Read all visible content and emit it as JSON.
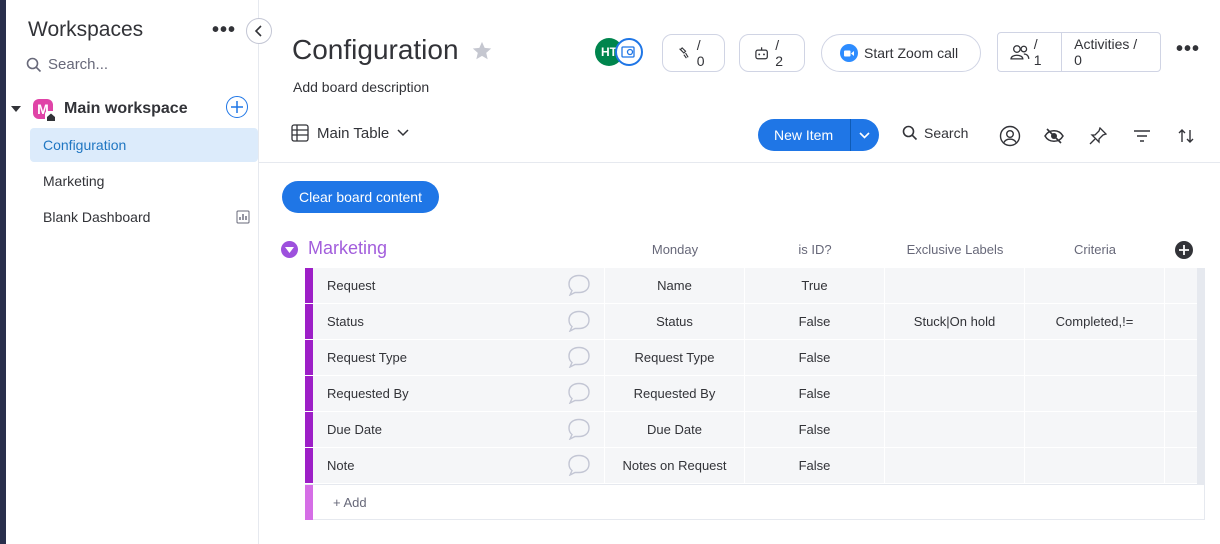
{
  "sidebar": {
    "title": "Workspaces",
    "search_placeholder": "Search...",
    "workspace": {
      "initial": "M",
      "name": "Main workspace"
    },
    "items": [
      {
        "label": "Configuration",
        "active": true
      },
      {
        "label": "Marketing",
        "active": false
      },
      {
        "label": "Blank Dashboard",
        "active": false
      }
    ]
  },
  "header": {
    "title": "Configuration",
    "description": "Add board description",
    "avatar_initials": "HT",
    "integrations_count": "/ 0",
    "automations_count": "/ 2",
    "zoom_label": "Start Zoom call",
    "members_count": "/ 1",
    "activities_label": "Activities / 0"
  },
  "toolbar": {
    "view_label": "Main Table",
    "new_item_label": "New Item",
    "search_label": "Search"
  },
  "clear_button": "Clear board content",
  "group": {
    "name": "Marketing",
    "color": "#a25ddc",
    "columns": [
      "Monday",
      "is ID?",
      "Exclusive Labels",
      "Criteria"
    ],
    "rows": [
      {
        "name": "Request",
        "monday": "Name",
        "is_id": "True",
        "exclusive": "",
        "criteria": ""
      },
      {
        "name": "Status",
        "monday": "Status",
        "is_id": "False",
        "exclusive": "Stuck|On hold",
        "criteria": "Completed,!="
      },
      {
        "name": "Request Type",
        "monday": "Request Type",
        "is_id": "False",
        "exclusive": "",
        "criteria": ""
      },
      {
        "name": "Requested By",
        "monday": "Requested By",
        "is_id": "False",
        "exclusive": "",
        "criteria": ""
      },
      {
        "name": "Due Date",
        "monday": "Due Date",
        "is_id": "False",
        "exclusive": "",
        "criteria": ""
      },
      {
        "name": "Note",
        "monday": "Notes on Request",
        "is_id": "False",
        "exclusive": "",
        "criteria": ""
      }
    ],
    "add_label": "+ Add"
  },
  "colors": {
    "accent": "#1f76e6",
    "group_bar": "#9d1fc7",
    "active_item": "#dcebfb"
  }
}
